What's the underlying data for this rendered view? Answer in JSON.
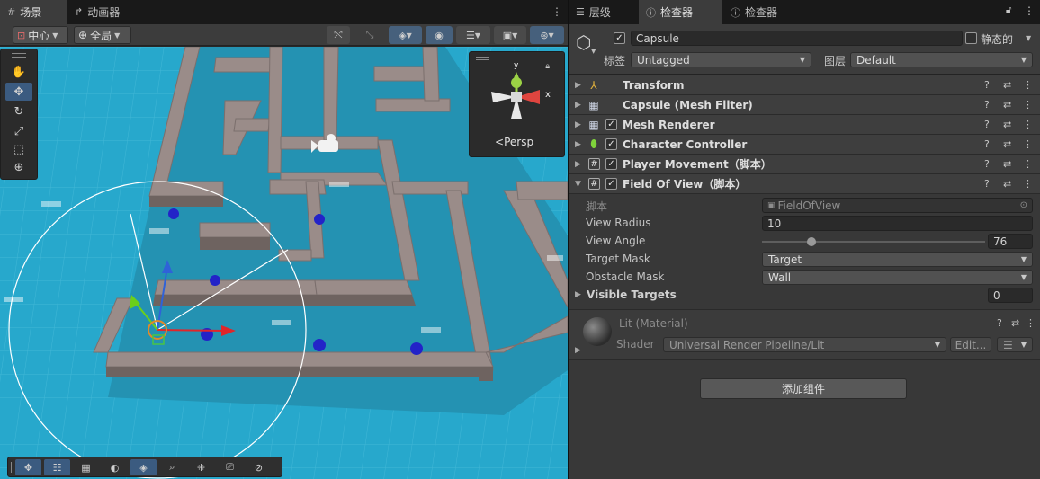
{
  "scene_tabs": [
    {
      "label": "场景",
      "icon": "grid-icon"
    },
    {
      "label": "动画器",
      "icon": "animator-icon"
    }
  ],
  "scene_toolbar": {
    "pivot_label": "中心",
    "space_label": "全局"
  },
  "gizmo": {
    "projection_label": "Persp",
    "axis_x": "x",
    "axis_y": "y"
  },
  "right_tabs": [
    {
      "label": "层级",
      "icon": "list-icon"
    },
    {
      "label": "检查器",
      "icon": "info-icon"
    },
    {
      "label": "检查器",
      "icon": "info-icon"
    }
  ],
  "object": {
    "name": "Capsule",
    "static_label": "静态的",
    "tag_label": "标签",
    "tag_value": "Untagged",
    "layer_label": "图层",
    "layer_value": "Default"
  },
  "components": [
    {
      "name": "Transform",
      "has_toggle": false
    },
    {
      "name": "Capsule (Mesh Filter)",
      "has_toggle": false
    },
    {
      "name": "Mesh Renderer",
      "has_toggle": true
    },
    {
      "name": "Character Controller",
      "has_toggle": true
    },
    {
      "name": "Player Movement（脚本）",
      "has_toggle": true
    },
    {
      "name": "Field Of View（脚本）",
      "has_toggle": true
    }
  ],
  "fov": {
    "script_label": "脚本",
    "script_value": "FieldOfView",
    "radius_label": "View Radius",
    "radius_value": "10",
    "angle_label": "View Angle",
    "angle_value": "76",
    "angle_fraction": 0.21,
    "target_mask_label": "Target Mask",
    "target_mask_value": "Target",
    "obstacle_mask_label": "Obstacle Mask",
    "obstacle_mask_value": "Wall",
    "visible_targets_label": "Visible Targets",
    "visible_targets_value": "0"
  },
  "material": {
    "name": "Lit (Material)",
    "shader_label": "Shader",
    "shader_value": "Universal Render Pipeline/Lit",
    "edit_label": "Edit..."
  },
  "add_component_label": "添加组件",
  "colors": {
    "floor": "#27a8cc",
    "wall": "#9a8c89",
    "accent": "#3b5b80"
  }
}
